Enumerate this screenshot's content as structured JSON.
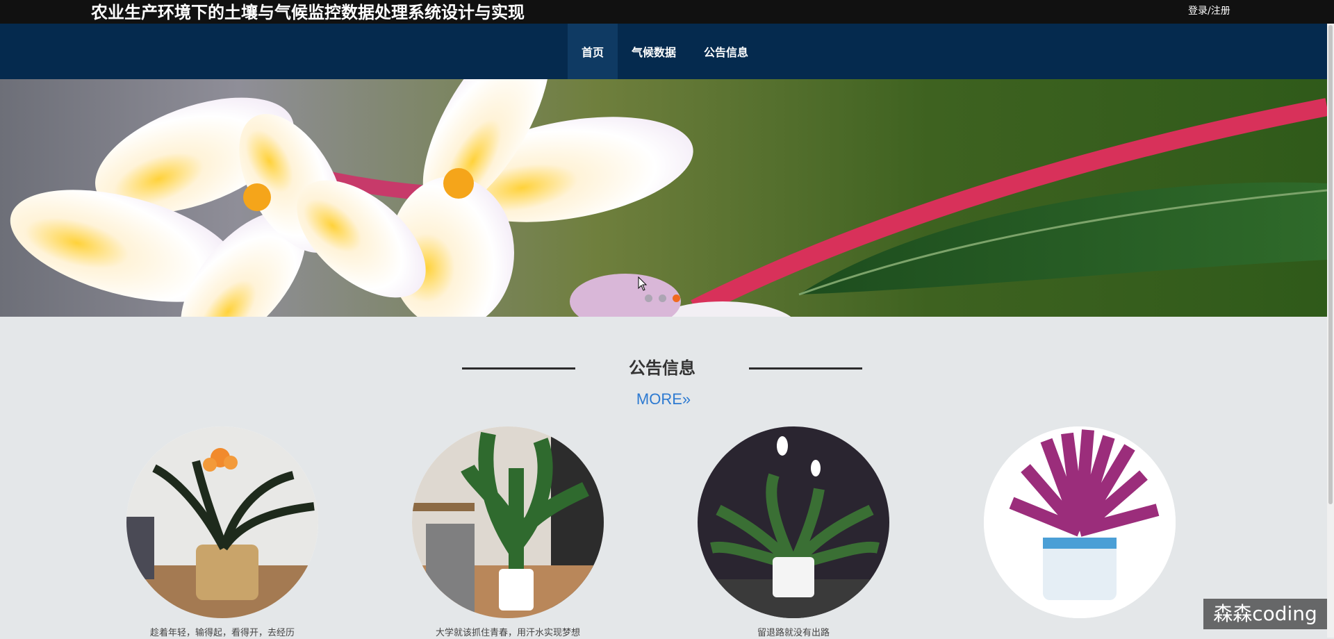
{
  "header": {
    "title": "农业生产环境下的土壤与气候监控数据处理系统设计与实现",
    "login_label": "登录/注册"
  },
  "nav": {
    "items": [
      {
        "label": "首页",
        "active": true
      },
      {
        "label": "气候数据",
        "active": false
      },
      {
        "label": "公告信息",
        "active": false
      }
    ]
  },
  "banner": {
    "slide_count": 3,
    "active_slide": 3
  },
  "section": {
    "title": "公告信息",
    "more_label": "MORE",
    "more_icon": "double-chevron-right-icon"
  },
  "cards": [
    {
      "caption": "趁着年轻，输得起，看得开，去经历",
      "image": "clivia-in-basket-image"
    },
    {
      "caption": "大学就该抓住青春，用汗水实现梦想",
      "image": "bird-of-paradise-plant-image"
    },
    {
      "caption": "留退路就没有出路",
      "image": "peace-lily-plant-image"
    },
    {
      "caption": "",
      "image": "purple-bromeliad-plant-image"
    }
  ],
  "watermark": {
    "text": "森森coding"
  },
  "colors": {
    "topbar": "#111111",
    "nav": "#052a4e",
    "nav_active": "#0f3a63",
    "more_link": "#2d7ad1",
    "active_dot": "#f06a1f"
  }
}
